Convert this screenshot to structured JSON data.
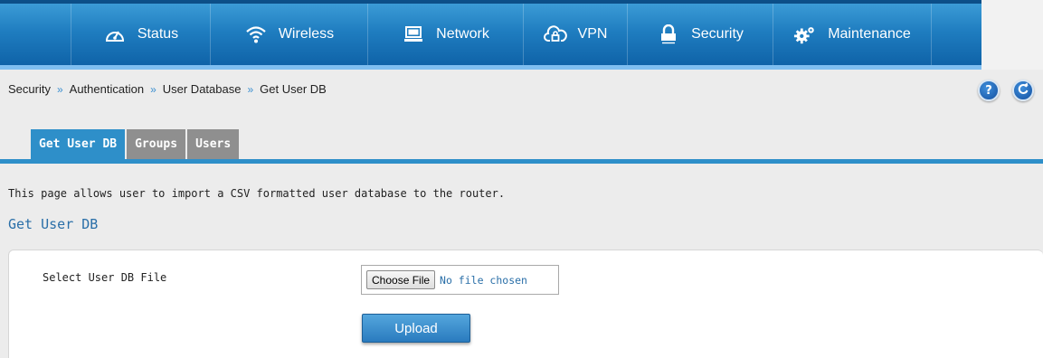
{
  "nav": {
    "items": [
      {
        "label": "Status",
        "icon": "dashboard-icon"
      },
      {
        "label": "Wireless",
        "icon": "wifi-icon"
      },
      {
        "label": "Network",
        "icon": "monitor-icon"
      },
      {
        "label": "VPN",
        "icon": "cloud-lock-icon"
      },
      {
        "label": "Security",
        "icon": "lock-icon",
        "active": true
      },
      {
        "label": "Maintenance",
        "icon": "gears-icon"
      }
    ]
  },
  "breadcrumb": {
    "items": [
      "Security",
      "Authentication",
      "User Database",
      "Get User DB"
    ],
    "separator": "»"
  },
  "header_buttons": {
    "help": "?",
    "refresh_icon": "refresh-icon"
  },
  "tabs": [
    {
      "label": "Get User DB",
      "active": true
    },
    {
      "label": "Groups",
      "active": false
    },
    {
      "label": "Users",
      "active": false
    }
  ],
  "intro_text": "This page allows user to import a CSV formatted user database to the router.",
  "section_title": "Get User DB",
  "form": {
    "field_label": "Select User DB File",
    "file_button": "Choose File",
    "file_status": "No file chosen",
    "upload_button": "Upload"
  },
  "colors": {
    "nav_blue": "#1f7dc0",
    "tab_active": "#2e8fc9",
    "tab_inactive": "#8f8f8f",
    "link_blue": "#2a6fa8"
  }
}
